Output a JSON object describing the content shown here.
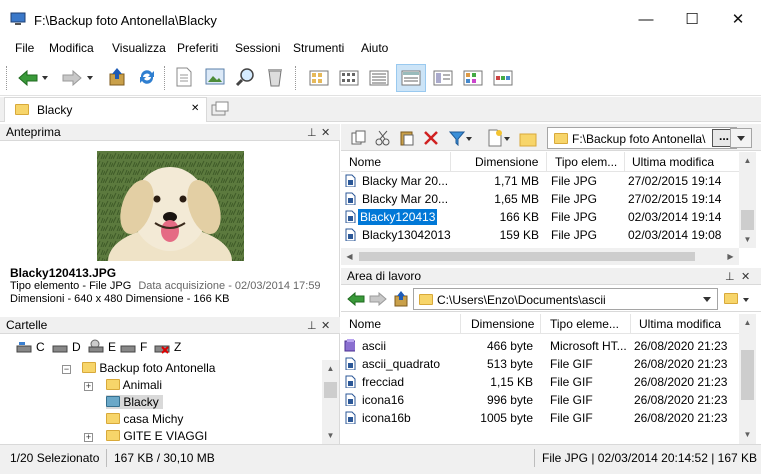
{
  "window": {
    "title": "F:\\Backup foto Antonella\\Blacky",
    "minimize": "—",
    "maximize": "☐",
    "close": "✕"
  },
  "menu": [
    "File",
    "Modifica",
    "Visualizza",
    "Preferiti",
    "Sessioni",
    "Strumenti",
    "Aiuto"
  ],
  "tabs": {
    "active_label": "Blacky",
    "close_glyph": "✕"
  },
  "preview": {
    "title": "Anteprima",
    "filename": "Blacky120413.JPG",
    "line1_a": "Tipo elemento - File JPG",
    "line1_b": "Data acquisizione - 02/03/2014 17:59",
    "line2": "Dimensioni - 640 x 480  Dimensione - 166 KB"
  },
  "folders": {
    "title": "Cartelle",
    "drives": [
      "C",
      "D",
      "E",
      "F",
      "Z"
    ],
    "tree": [
      {
        "label": "Backup foto Antonella"
      },
      {
        "label": "Animali"
      },
      {
        "label": "Blacky"
      },
      {
        "label": "casa Michy"
      },
      {
        "label": "GITE E VIAGGI"
      }
    ]
  },
  "top_pane": {
    "address": "F:\\Backup foto Antonella\\",
    "address_more": "...",
    "columns": [
      "Nome",
      "Dimensione",
      "Tipo elem...",
      "Ultima modifica"
    ],
    "files": [
      {
        "name": "Blacky Mar 20...",
        "size": "1,71 MB",
        "type": "File JPG",
        "modified": "27/02/2015 19:14"
      },
      {
        "name": "Blacky Mar 20...",
        "size": "1,65 MB",
        "type": "File JPG",
        "modified": "27/02/2015 19:14"
      },
      {
        "name": "Blacky120413",
        "size": "166 KB",
        "type": "File JPG",
        "modified": "02/03/2014 19:14"
      },
      {
        "name": "Blacky13042013",
        "size": "159 KB",
        "type": "File JPG",
        "modified": "02/03/2014 19:08"
      }
    ]
  },
  "bottom_pane": {
    "title": "Area di lavoro",
    "address": "C:\\Users\\Enzo\\Documents\\ascii",
    "columns": [
      "Nome",
      "Dimensione",
      "Tipo eleme...",
      "Ultima modifica"
    ],
    "files": [
      {
        "name": "ascii",
        "size": "466 byte",
        "type": "Microsoft HT...",
        "modified": "26/08/2020 21:23"
      },
      {
        "name": "ascii_quadrato",
        "size": "513 byte",
        "type": "File GIF",
        "modified": "26/08/2020 21:23"
      },
      {
        "name": "frecciad",
        "size": "1,15 KB",
        "type": "File GIF",
        "modified": "26/08/2020 21:23"
      },
      {
        "name": "icona16",
        "size": "996 byte",
        "type": "File GIF",
        "modified": "26/08/2020 21:23"
      },
      {
        "name": "icona16b",
        "size": "1005 byte",
        "type": "File GIF",
        "modified": "26/08/2020 21:23"
      }
    ]
  },
  "status": {
    "selected": "1/20 Selezionato",
    "size": "167 KB / 30,10 MB",
    "info": "File JPG | 02/03/2014 20:14:52 | 167 KB"
  },
  "colors": {
    "selection": "#0078d7",
    "folder": "#f7d56a",
    "panel_bg": "#f0f0f0"
  }
}
